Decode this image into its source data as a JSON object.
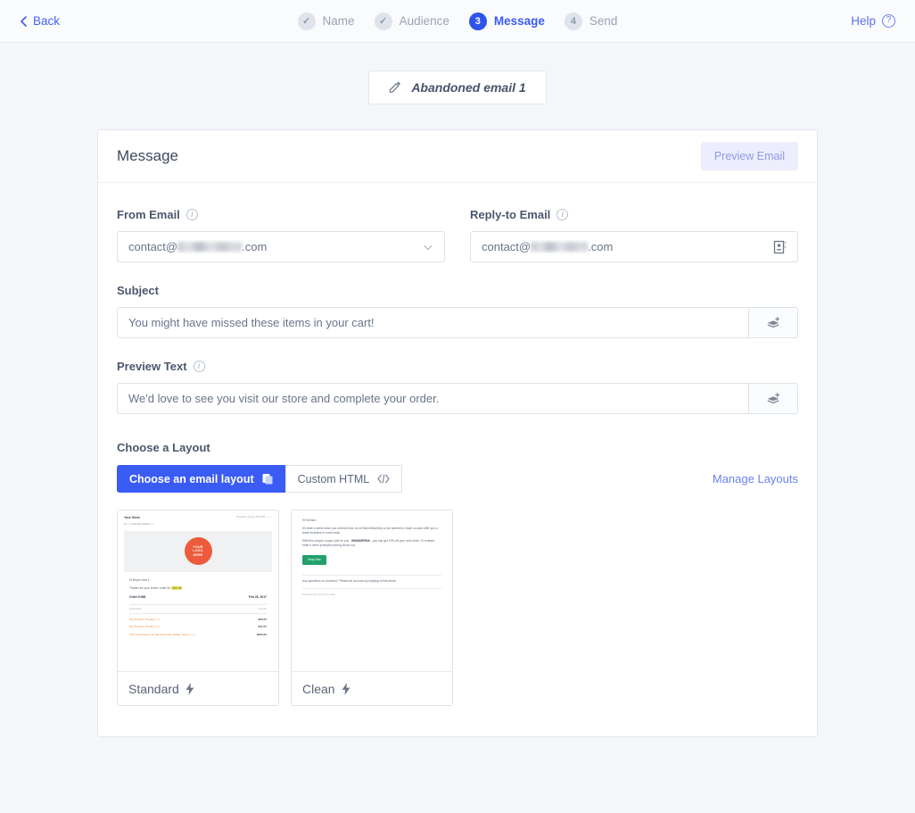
{
  "topbar": {
    "back_label": "Back",
    "help_label": "Help",
    "steps": [
      {
        "mark": "✓",
        "label": "Name",
        "state": "done"
      },
      {
        "mark": "✓",
        "label": "Audience",
        "state": "done"
      },
      {
        "mark": "3",
        "label": "Message",
        "state": "active"
      },
      {
        "mark": "4",
        "label": "Send",
        "state": "upcoming"
      }
    ]
  },
  "email_chip": {
    "label": "Abandoned email 1",
    "icon": "edit-pencil-icon"
  },
  "card": {
    "title": "Message",
    "preview_button": "Preview Email"
  },
  "fields": {
    "from_email": {
      "label": "From Email",
      "value_prefix": "contact@",
      "value_suffix": ".com",
      "redacted": true
    },
    "reply_to_email": {
      "label": "Reply-to Email",
      "value_prefix": "contact@",
      "value_suffix": ".com",
      "redacted": true,
      "icon": "address-book-icon"
    },
    "subject": {
      "label": "Subject",
      "value": "You might have missed these items in your cart!",
      "action_icon": "merge-tag-icon"
    },
    "preview_text": {
      "label": "Preview Text",
      "value": "We'd love to see you visit our store and complete your order.",
      "action_icon": "merge-tag-icon"
    }
  },
  "layout": {
    "heading": "Choose a Layout",
    "tabs": [
      {
        "label": "Choose an email layout",
        "icon": "device-preview-icon",
        "active": true
      },
      {
        "label": "Custom HTML",
        "icon": "code-icon",
        "active": false
      }
    ],
    "manage_link": "Manage Layouts",
    "thumbnails": [
      {
        "name": "Standard",
        "badge_icon": "lightning-bolt-icon",
        "preview": {
          "store": "Your Store",
          "date": "Thursday, 31 Aug, 8:53 PM",
          "to": "To: << Test First Name >>",
          "logo": "YOUR LOGO HERE",
          "greeting": "Hi Bryce Now 1,",
          "intro_pre": "Thanks for your recent order for ",
          "intro_hl": "$86.38",
          "intro_post": ".",
          "order_label": "Order K088",
          "order_date": "Feb 28, 2017",
          "col_desc": "Description",
          "col_amount": "Amount",
          "items": [
            {
              "name": "My Preorder Product × 1",
              "amount": "$60.00"
            },
            {
              "name": "My Preorder Product × 1",
              "amount": "$41.07"
            },
            {
              "name": "The Confessions Of Nat Turner By William Styron × 2",
              "amount": "$160.63"
            }
          ]
        }
      },
      {
        "name": "Clean",
        "badge_icon": "lightning-bolt-icon",
        "preview": {
          "greeting": "Hi Vernice,",
          "p1": "It's been a while since you ordered from us at RamenMonthly so we wanted to reach out and offer you a small incentive to come back.",
          "p2_pre": "With this unique coupon just for you - ",
          "p2_code": "98SAB5P90A",
          "p2_post": " - you can get 10% off your next order. To redeem, enter it when prompted during check out.",
          "button": "Shop Now",
          "p3": "Any questions or concerns? Please let us know by replying to this email.",
          "unsub": "Unsubscribe from our emails"
        }
      }
    ]
  },
  "colors": {
    "accent": "#3b5bf5",
    "link": "#6b82f2",
    "page_bg": "#f4f6f9",
    "logo_orange": "#ec5b3b",
    "cta_green": "#22a06b",
    "highlight_yellow": "#f5ee52"
  }
}
